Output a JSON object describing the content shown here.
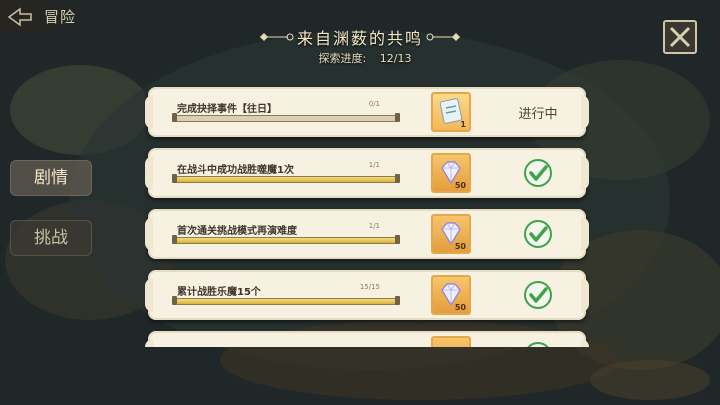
{
  "header": {
    "title": "冒险"
  },
  "side_tabs": [
    {
      "label": "剧情",
      "active": true
    },
    {
      "label": "挑战",
      "active": false
    }
  ],
  "dialog": {
    "title": "来自渊薮的共鸣",
    "progress_label": "探索进度:",
    "progress_value": "12/13"
  },
  "quests": [
    {
      "text": "完成抉择事件【往日】",
      "count": "0/1",
      "progress": 0.0,
      "reward_icon": "ticket-icon",
      "reward_qty": "1",
      "status": "进行中",
      "completed": false
    },
    {
      "text": "在战斗中成功战胜噬魔1次",
      "count": "1/1",
      "progress": 1.0,
      "reward_icon": "diamond-icon",
      "reward_qty": "50",
      "status": "",
      "completed": true
    },
    {
      "text": "首次通关挑战模式再演难度",
      "count": "1/1",
      "progress": 1.0,
      "reward_icon": "diamond-icon",
      "reward_qty": "50",
      "status": "",
      "completed": true
    },
    {
      "text": "累计战胜乐魔15个",
      "count": "15/15",
      "progress": 1.0,
      "reward_icon": "diamond-icon",
      "reward_qty": "50",
      "status": "",
      "completed": true
    },
    {
      "text": "",
      "count": "",
      "progress": 1.0,
      "reward_icon": "",
      "reward_qty": "",
      "status": "",
      "completed": true
    }
  ],
  "colors": {
    "check_green": "#3fa24a",
    "bar_fill": "#e8c75a",
    "reward_gold": "#eaa54a"
  }
}
